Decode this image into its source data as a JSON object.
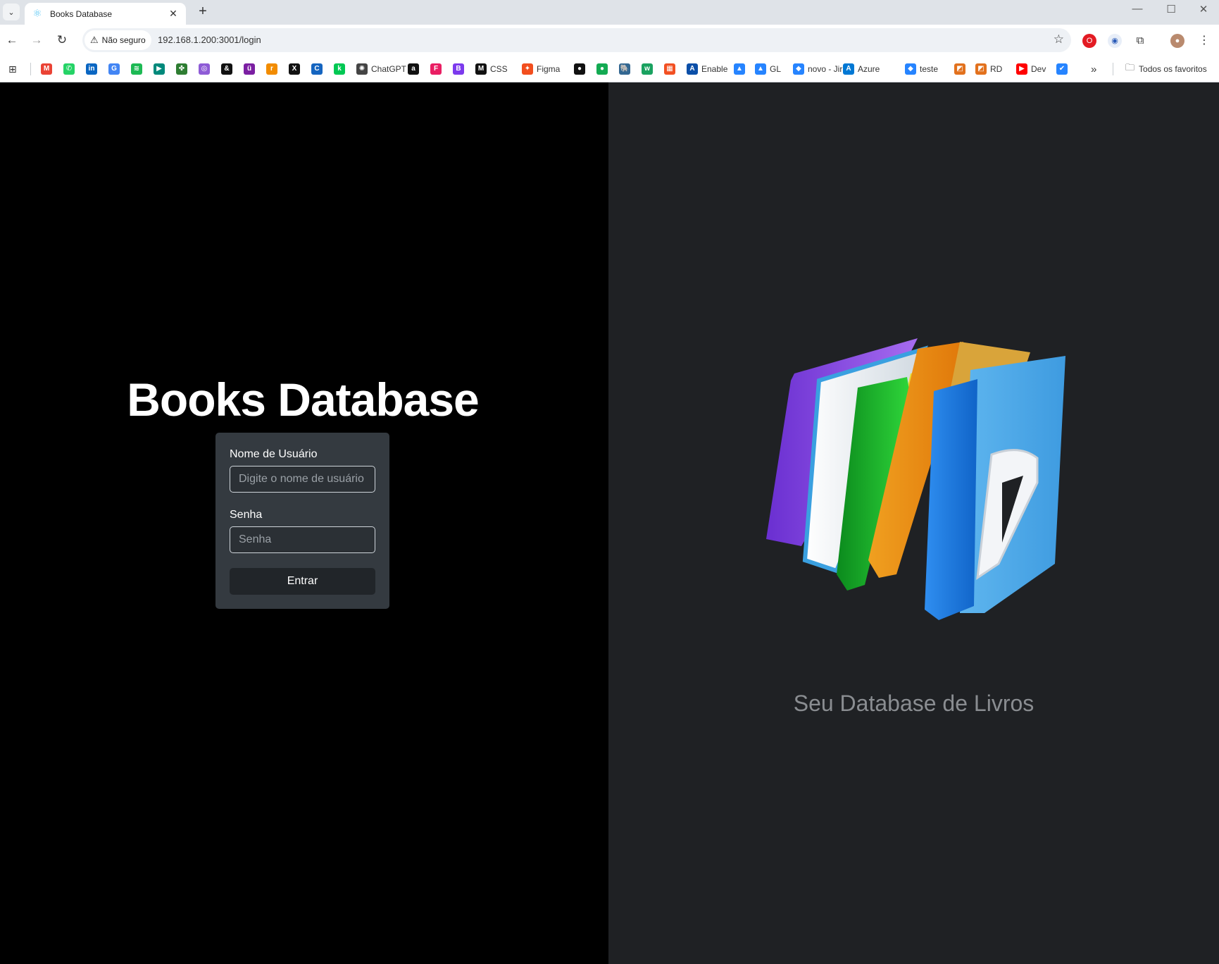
{
  "browser": {
    "tab": {
      "title": "Books Database",
      "favicon": "react-icon"
    },
    "security_label": "Não seguro",
    "url": "192.168.1.200:3001/login",
    "bookmarks": [
      {
        "label": "",
        "icon": "gmail-icon",
        "color": "#ea4335",
        "glyph": "M"
      },
      {
        "label": "",
        "icon": "whatsapp-icon",
        "color": "#25d366",
        "glyph": "✆"
      },
      {
        "label": "",
        "icon": "linkedin-icon",
        "color": "#0a66c2",
        "glyph": "in"
      },
      {
        "label": "",
        "icon": "translate-icon",
        "color": "#4285f4",
        "glyph": "G"
      },
      {
        "label": "",
        "icon": "spotify-icon",
        "color": "#1db954",
        "glyph": "≋"
      },
      {
        "label": "",
        "icon": "meet-icon",
        "color": "#00897b",
        "glyph": "▶"
      },
      {
        "label": "",
        "icon": "apps-cluster-icon",
        "color": "#2e7d32",
        "glyph": "✤"
      },
      {
        "label": "",
        "icon": "purple-app-icon",
        "color": "#8e5bd6",
        "glyph": "◎"
      },
      {
        "label": "",
        "icon": "ampersand-icon",
        "color": "#111111",
        "glyph": "&"
      },
      {
        "label": "",
        "icon": "utility-icon",
        "color": "#7b1fa2",
        "glyph": "ü"
      },
      {
        "label": "",
        "icon": "rtve-icon",
        "color": "#f28c00",
        "glyph": "r"
      },
      {
        "label": "",
        "icon": "x-icon",
        "color": "#111111",
        "glyph": "X"
      },
      {
        "label": "",
        "icon": "c-icon",
        "color": "#1565c0",
        "glyph": "C"
      },
      {
        "label": "",
        "icon": "green-k-icon",
        "color": "#00c853",
        "glyph": "k"
      },
      {
        "label": "ChatGPT",
        "icon": "chatgpt-icon",
        "color": "#444444",
        "glyph": "✺"
      },
      {
        "label": "",
        "icon": "a-icon",
        "color": "#111111",
        "glyph": "a"
      },
      {
        "label": "",
        "icon": "f-icon",
        "color": "#e91e63",
        "glyph": "F"
      },
      {
        "label": "",
        "icon": "b-icon",
        "color": "#7c3aed",
        "glyph": "B"
      },
      {
        "label": "CSS",
        "icon": "css-icon",
        "color": "#111111",
        "glyph": "M"
      },
      {
        "label": "Figma",
        "icon": "figma-icon",
        "color": "#f24e1e",
        "glyph": "✦"
      },
      {
        "label": "",
        "icon": "github-icon",
        "color": "#111111",
        "glyph": "●"
      },
      {
        "label": "",
        "icon": "leaf-icon",
        "color": "#13aa52",
        "glyph": "●"
      },
      {
        "label": "",
        "icon": "postgres-icon",
        "color": "#336791",
        "glyph": "🐘"
      },
      {
        "label": "",
        "icon": "w-icon",
        "color": "#1aa260",
        "glyph": "w"
      },
      {
        "label": "",
        "icon": "microsoft-icon",
        "color": "#f25022",
        "glyph": "▦"
      },
      {
        "label": "Enable",
        "icon": "enable-icon",
        "color": "#0b4fa8",
        "glyph": "A"
      },
      {
        "label": "",
        "icon": "atlassian-icon",
        "color": "#2684ff",
        "glyph": "▲"
      },
      {
        "label": "GL",
        "icon": "atlassian-gl-icon",
        "color": "#2684ff",
        "glyph": "▲"
      },
      {
        "label": "novo - Jira",
        "icon": "jira-icon",
        "color": "#2684ff",
        "glyph": "◆"
      },
      {
        "label": "Azure",
        "icon": "azure-icon",
        "color": "#0078d4",
        "glyph": "A"
      },
      {
        "label": "teste",
        "icon": "jira-teste-icon",
        "color": "#2684ff",
        "glyph": "◆"
      },
      {
        "label": "",
        "icon": "orange-slash-icon",
        "color": "#e2711d",
        "glyph": "◩"
      },
      {
        "label": "RD",
        "icon": "rd-icon",
        "color": "#e2711d",
        "glyph": "◩"
      },
      {
        "label": "Dev",
        "icon": "youtube-icon",
        "color": "#ff0000",
        "glyph": "▶"
      },
      {
        "label": "",
        "icon": "check-icon",
        "color": "#2684ff",
        "glyph": "✔"
      }
    ],
    "more_bookmarks": "»",
    "all_bookmarks_label": "Todos os favoritos"
  },
  "page": {
    "title": "Books Database",
    "form": {
      "username_label": "Nome de Usuário",
      "username_placeholder": "Digite o nome de usuário",
      "username_value": "",
      "password_label": "Senha",
      "password_placeholder": "Senha",
      "password_value": "",
      "submit_label": "Entrar"
    },
    "tagline": "Seu Database de Livros"
  },
  "colors": {
    "left_bg": "#000000",
    "right_bg": "#1f2124",
    "card_bg": "#343a40",
    "button_bg": "#212529",
    "tagline": "#8a8d91"
  }
}
